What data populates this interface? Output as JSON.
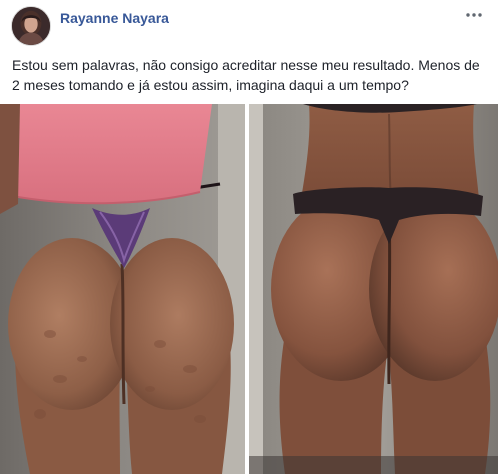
{
  "post": {
    "author_name": "Rayanne Nayara",
    "text": "Estou sem palavras, não consigo acreditar nesse meu resultado. Menos de 2 meses tomando e já estou assim, imagina daqui a um tempo?",
    "more_icon": "more-horizontal-icon"
  },
  "photos": [
    {
      "name": "photo-before"
    },
    {
      "name": "photo-after"
    }
  ],
  "colors": {
    "author_link": "#385898",
    "body_text": "#1d2129",
    "more_icon": "#606770"
  }
}
